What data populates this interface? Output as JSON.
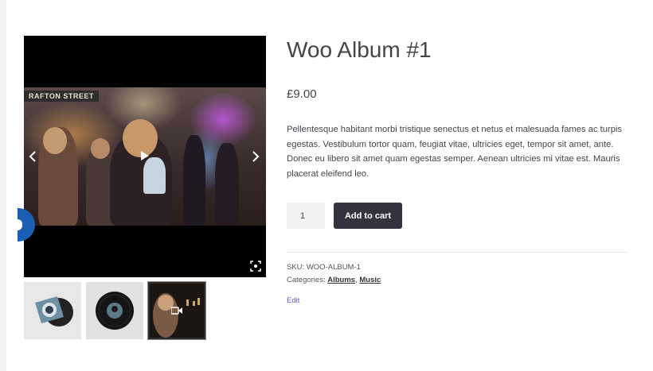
{
  "product": {
    "title": "Woo Album #1",
    "price": "£9.00",
    "description": "Pellentesque habitant morbi tristique senectus et netus et malesuada fames ac turpis egestas. Vestibulum tortor quam, feugiat vitae, ultricies eget, tempor sit amet, ante. Donec eu libero sit amet quam egestas semper. Aenean ultricies mi vitae est. Mauris placerat eleifend leo.",
    "quantity": "1",
    "add_to_cart_label": "Add to cart",
    "sku_label": "SKU:",
    "sku_value": "WOO-ALBUM-1",
    "categories_label": "Categories:",
    "categories": [
      "Albums",
      "Music"
    ],
    "category_separator": ", ",
    "edit_label": "Edit"
  },
  "gallery": {
    "video_overlay_text": "RAFTON STREET",
    "thumbnails": [
      {
        "name": "album-cover-thumbnail"
      },
      {
        "name": "vinyl-record-thumbnail"
      },
      {
        "name": "video-thumbnail",
        "icon": "video-camera-icon",
        "selected": true
      }
    ]
  },
  "colors": {
    "button_bg": "#333340",
    "link_edit": "#5b5bc8",
    "bubble": "#1a5fb4"
  }
}
